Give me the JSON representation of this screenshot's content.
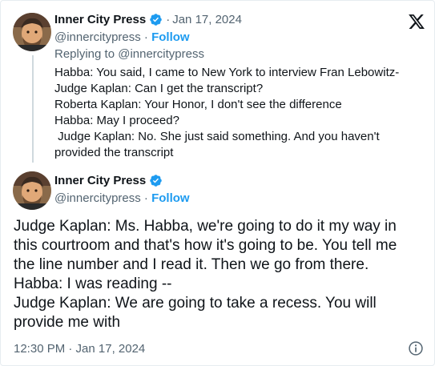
{
  "colors": {
    "accent": "#1d9bf0",
    "text": "#0f1419",
    "muted": "#536471",
    "thread_line": "#cfd9de"
  },
  "icons": {
    "logo": "x-logo-icon",
    "verified": "verified-badge-icon",
    "info": "info-icon"
  },
  "reply_tweet": {
    "author_name": "Inner City Press",
    "separator": "·",
    "date": "Jan 17, 2024",
    "handle": "@innercitypress",
    "handle_sep": " · ",
    "follow_label": "Follow",
    "replying_to": "Replying to @innercitypress",
    "text": "Habba: You said, I came to New York to interview Fran Lebowitz-\nJudge Kaplan: Can I get the transcript?\nRoberta Kaplan: Your Honor, I don't see the difference\nHabba: May I proceed?\n Judge Kaplan: No. She just said something. And you haven't\nprovided the transcript"
  },
  "main_tweet": {
    "author_name": "Inner City Press",
    "handle": "@innercitypress",
    "handle_sep": " · ",
    "follow_label": "Follow",
    "text": "Judge Kaplan: Ms. Habba, we're going to do it my way in\nthis courtroom and that's how it's going to be. You tell me\nthe line number and I read it. Then we go from there.\nHabba: I was reading --\nJudge Kaplan: We are going to take a recess. You will\nprovide me with",
    "timestamp": "12:30 PM · Jan 17, 2024"
  }
}
